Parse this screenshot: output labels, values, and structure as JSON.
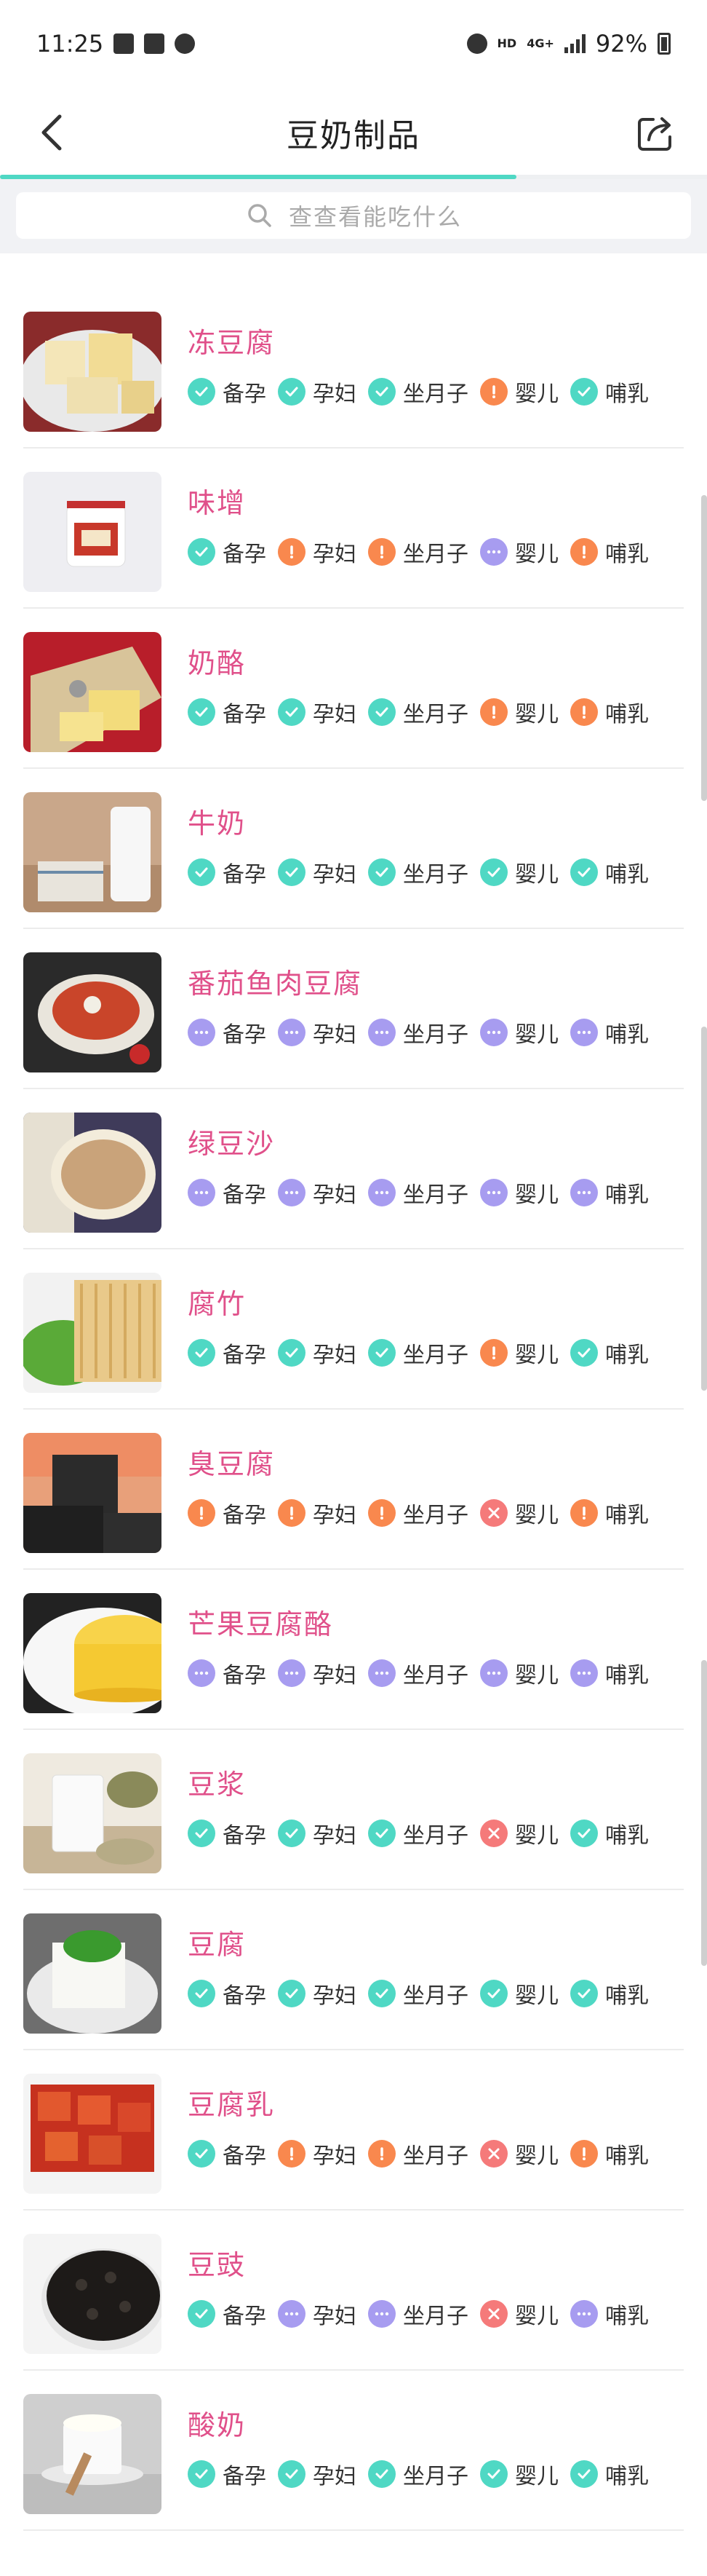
{
  "status_bar": {
    "time": "11:25",
    "network": "HD",
    "network_gen": "4G+",
    "battery": "92%"
  },
  "header": {
    "title": "豆奶制品",
    "back_icon": "chevron-left-icon",
    "share_icon": "share-icon",
    "scroll_progress": 0.73
  },
  "search": {
    "placeholder": "查查看能吃什么"
  },
  "colors": {
    "ok": "#4fd8c4",
    "warn": "#f9884e",
    "no": "#f57a7a",
    "unknown": "#a79cf0",
    "name": "#e0508a"
  },
  "categories": [
    "备孕",
    "孕妇",
    "坐月子",
    "婴儿",
    "哺乳"
  ],
  "items": [
    {
      "name": "冻豆腐",
      "thumb": "frozen-tofu",
      "status": [
        "ok",
        "ok",
        "ok",
        "warn",
        "ok"
      ]
    },
    {
      "name": "味增",
      "thumb": "miso",
      "status": [
        "ok",
        "warn",
        "warn",
        "unk",
        "warn"
      ]
    },
    {
      "name": "奶酪",
      "thumb": "cheese",
      "status": [
        "ok",
        "ok",
        "ok",
        "warn",
        "warn"
      ]
    },
    {
      "name": "牛奶",
      "thumb": "milk",
      "status": [
        "ok",
        "ok",
        "ok",
        "ok",
        "ok"
      ]
    },
    {
      "name": "番茄鱼肉豆腐",
      "thumb": "tomato-fish-tofu",
      "status": [
        "unk",
        "unk",
        "unk",
        "unk",
        "unk"
      ]
    },
    {
      "name": "绿豆沙",
      "thumb": "mung-bean-soup",
      "status": [
        "unk",
        "unk",
        "unk",
        "unk",
        "unk"
      ]
    },
    {
      "name": "腐竹",
      "thumb": "tofu-skin",
      "status": [
        "ok",
        "ok",
        "ok",
        "warn",
        "ok"
      ]
    },
    {
      "name": "臭豆腐",
      "thumb": "stinky-tofu",
      "status": [
        "warn",
        "warn",
        "warn",
        "no",
        "warn"
      ]
    },
    {
      "name": "芒果豆腐酪",
      "thumb": "mango-pudding",
      "status": [
        "unk",
        "unk",
        "unk",
        "unk",
        "unk"
      ]
    },
    {
      "name": "豆浆",
      "thumb": "soy-milk",
      "status": [
        "ok",
        "ok",
        "ok",
        "no",
        "ok"
      ]
    },
    {
      "name": "豆腐",
      "thumb": "tofu",
      "status": [
        "ok",
        "ok",
        "ok",
        "ok",
        "ok"
      ]
    },
    {
      "name": "豆腐乳",
      "thumb": "fermented-tofu",
      "status": [
        "ok",
        "warn",
        "warn",
        "no",
        "warn"
      ]
    },
    {
      "name": "豆豉",
      "thumb": "fermented-black-beans",
      "status": [
        "ok",
        "unk",
        "unk",
        "no",
        "unk"
      ]
    },
    {
      "name": "酸奶",
      "thumb": "yogurt",
      "status": [
        "ok",
        "ok",
        "ok",
        "ok",
        "ok"
      ]
    }
  ]
}
